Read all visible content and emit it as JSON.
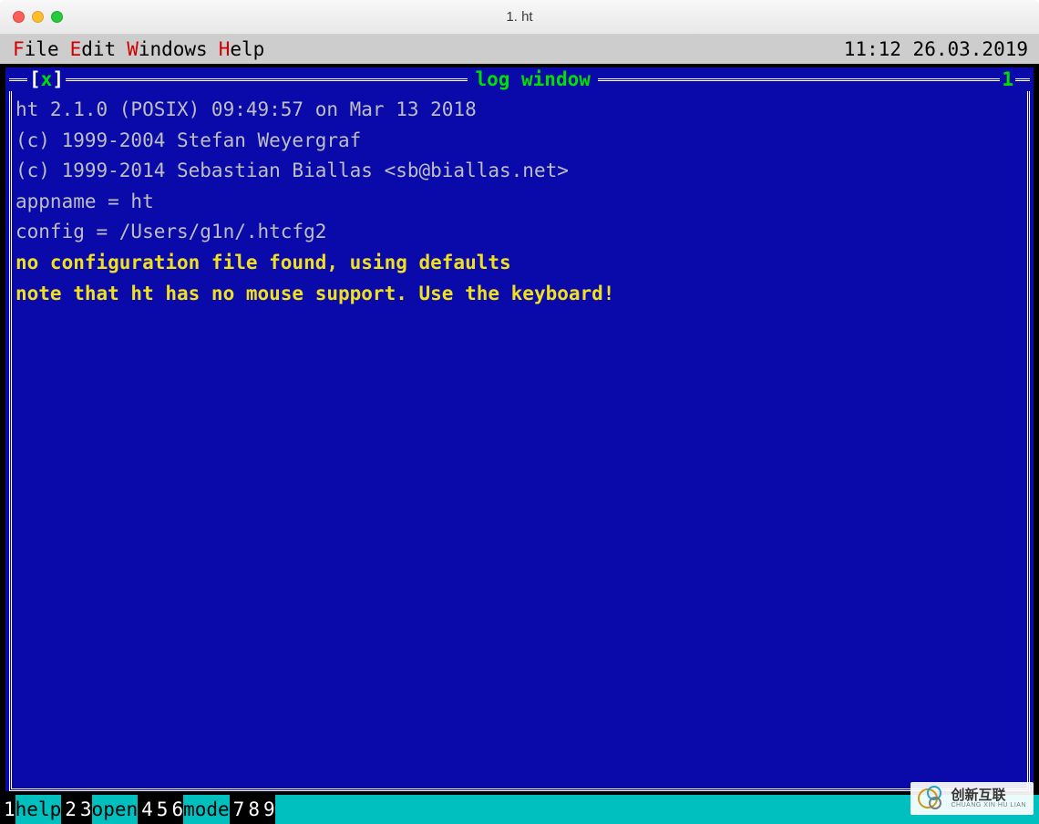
{
  "window": {
    "title": "1. ht"
  },
  "menubar": {
    "items": [
      {
        "hotkey": "F",
        "rest": "ile"
      },
      {
        "hotkey": "E",
        "rest": "dit"
      },
      {
        "hotkey": "W",
        "rest": "indows"
      },
      {
        "hotkey": "H",
        "rest": "elp"
      }
    ],
    "datetime": "11:12 26.03.2019"
  },
  "logwindow": {
    "close_x": "x",
    "title": "log window",
    "index": "1",
    "lines": [
      "ht 2.1.0 (POSIX) 09:49:57 on Mar 13 2018",
      "(c) 1999-2004 Stefan Weyergraf",
      "(c) 1999-2014 Sebastian Biallas <sb@biallas.net>",
      "appname = ht",
      "config = /Users/g1n/.htcfg2"
    ],
    "yellow_lines": [
      "no configuration file found, using defaults",
      "note that ht has no mouse support. Use the keyboard!"
    ]
  },
  "funcbar": {
    "items": [
      {
        "num": "1",
        "label": "help"
      },
      {
        "num": "2",
        "label": ""
      },
      {
        "num": "3",
        "label": "open"
      },
      {
        "num": "4",
        "label": ""
      },
      {
        "num": "5",
        "label": ""
      },
      {
        "num": "6",
        "label": "mode"
      },
      {
        "num": "7",
        "label": ""
      },
      {
        "num": "8",
        "label": ""
      },
      {
        "num": "9",
        "label": ""
      }
    ]
  },
  "watermark": {
    "cn": "创新互联",
    "en": "CHUANG XIN HU LIAN"
  }
}
